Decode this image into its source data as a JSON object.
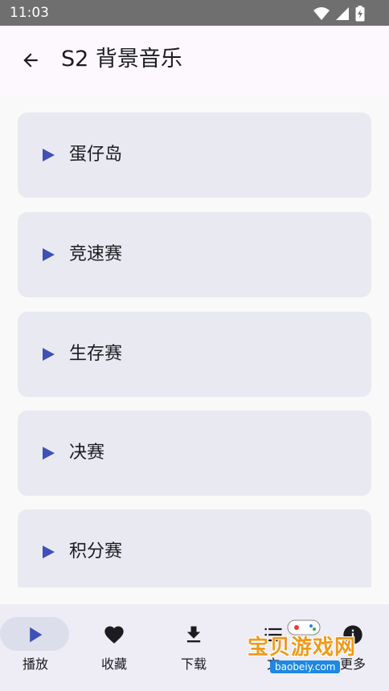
{
  "status_bar": {
    "time": "11:03",
    "icons": [
      "wifi-icon",
      "signal-icon",
      "battery-icon"
    ]
  },
  "header": {
    "title": "S2 背景音乐",
    "back_icon": "arrow-left-icon"
  },
  "tracks": [
    {
      "label": "蛋仔岛"
    },
    {
      "label": "竞速赛"
    },
    {
      "label": "生存赛"
    },
    {
      "label": "决赛"
    },
    {
      "label": "积分赛"
    }
  ],
  "bottom_nav": {
    "items": [
      {
        "label": "播放",
        "icon": "play-icon",
        "selected": true
      },
      {
        "label": "收藏",
        "icon": "heart-icon",
        "selected": false
      },
      {
        "label": "下载",
        "icon": "download-icon",
        "selected": false
      },
      {
        "label": "文",
        "icon": "list-icon",
        "selected": false
      },
      {
        "label": "更多",
        "icon": "info-icon",
        "selected": false
      }
    ]
  },
  "watermark": {
    "text": "宝贝游戏网",
    "url": "baobeiy.com"
  },
  "colors": {
    "status_bar": "#6f6f6f",
    "app_bar": "#fdf8fd",
    "card": "#e9e9f1",
    "accent": "#3f51b5",
    "nav_bg": "#eeecf4",
    "nav_indicator": "#dcdfeb"
  }
}
